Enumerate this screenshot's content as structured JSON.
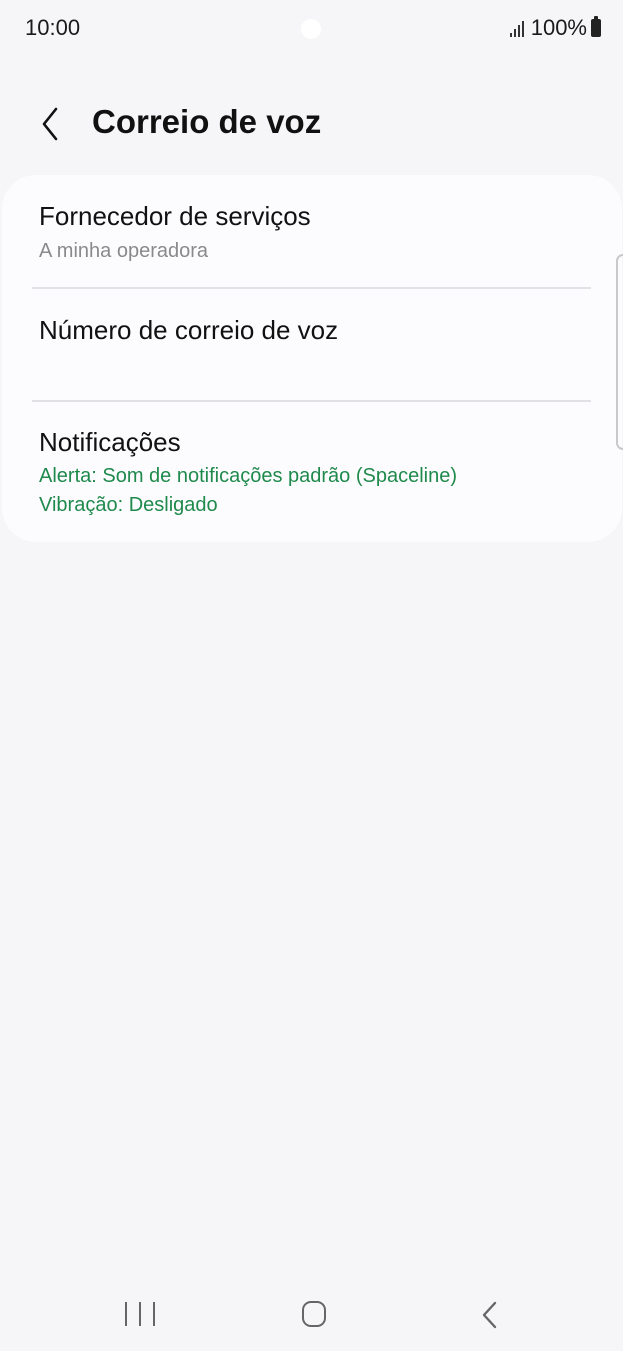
{
  "status_bar": {
    "time": "10:00",
    "battery": "100%",
    "icons": [
      "signal-icon",
      "battery-icon"
    ]
  },
  "header": {
    "title": "Correio de voz",
    "back_icon": "chevron-left-icon"
  },
  "settings": [
    {
      "title": "Fornecedor de serviços",
      "subtitle": "A minha operadora"
    },
    {
      "title": "Número de correio de voz"
    },
    {
      "title": "Notificações",
      "alert": "Alerta: Som de notificações padrão (Spaceline)",
      "vibration": "Vibração: Desligado"
    }
  ],
  "colors": {
    "background": "#f6f6f8",
    "card": "#fcfcfe",
    "accent_green": "#1f8a4c",
    "subtitle_gray": "#8a8a8a"
  },
  "nav_bar": {
    "icons": [
      "recents-icon",
      "home-icon",
      "back-icon"
    ]
  }
}
